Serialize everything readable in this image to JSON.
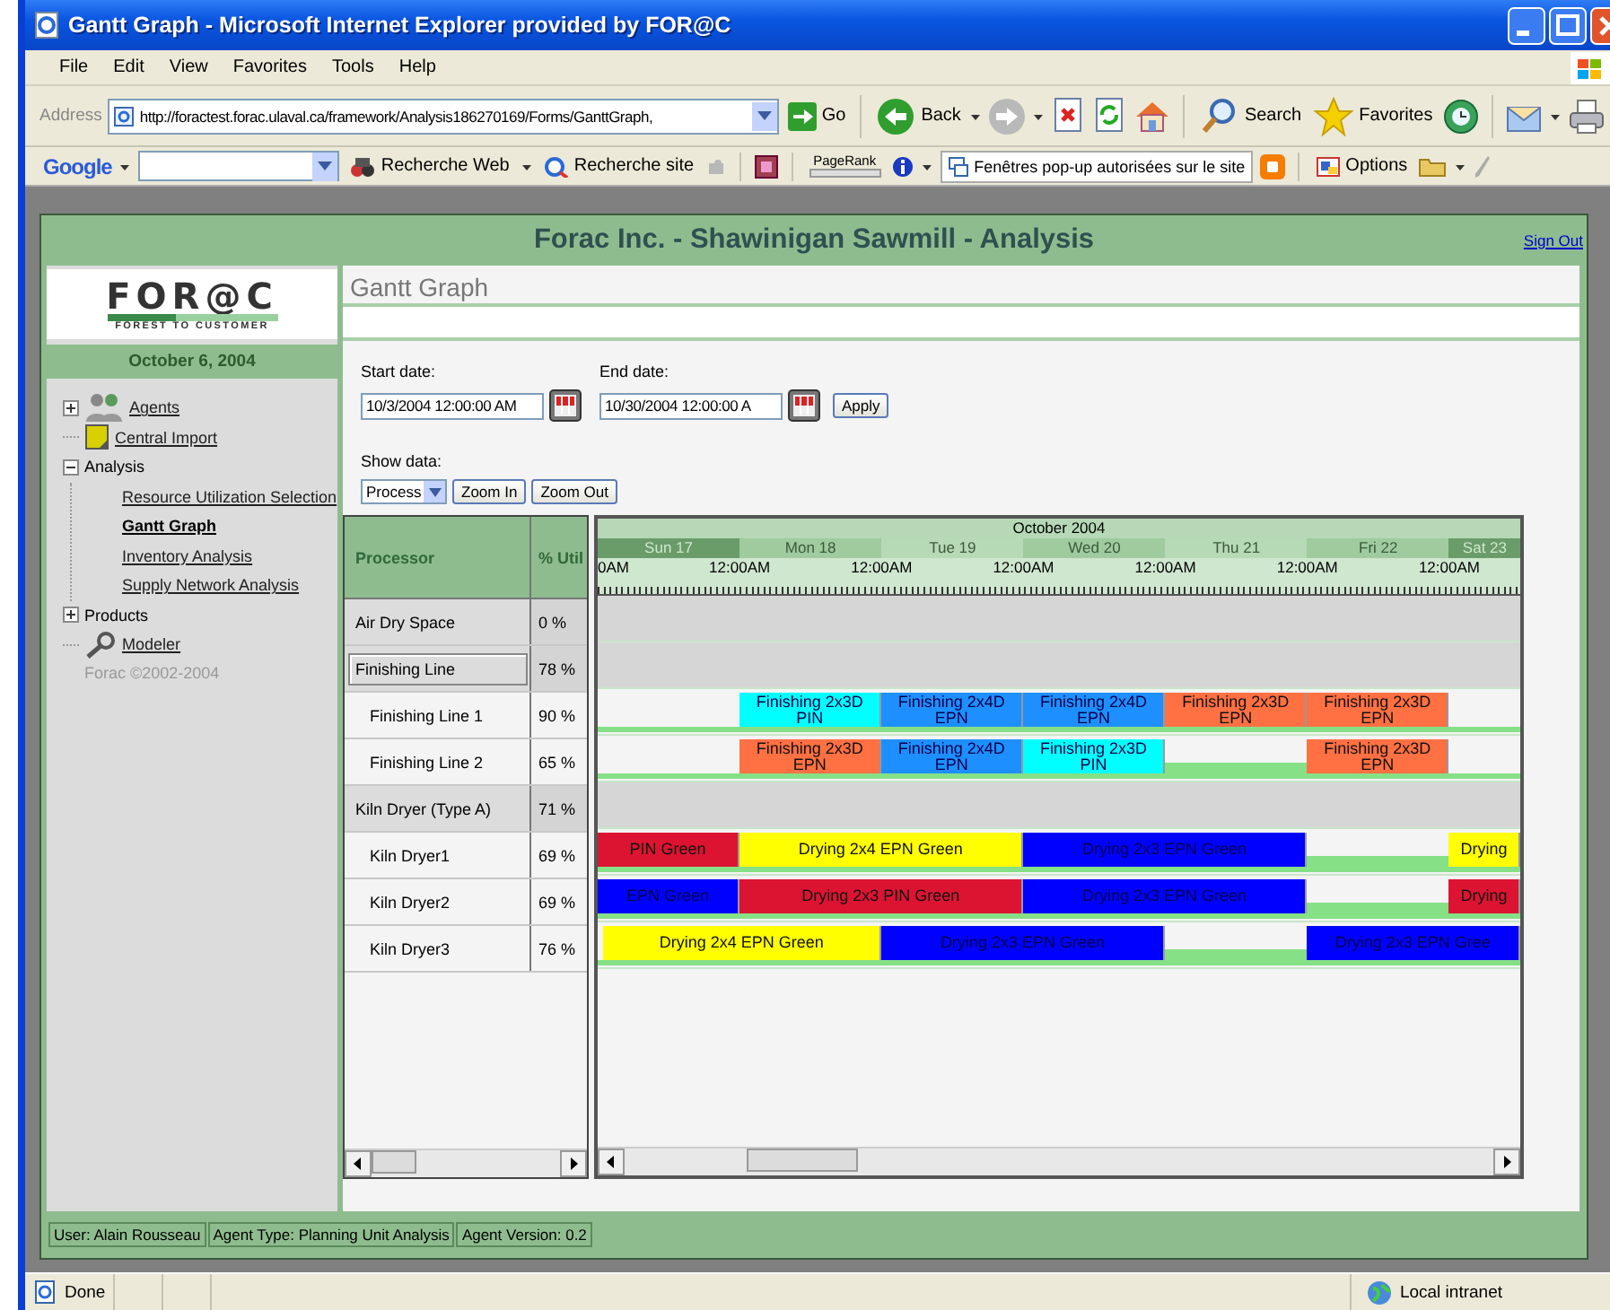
{
  "window": {
    "title": "Gantt Graph - Microsoft Internet Explorer provided by FOR@C"
  },
  "menu": [
    "File",
    "Edit",
    "View",
    "Favorites",
    "Tools",
    "Help"
  ],
  "address_bar": {
    "label": "Address",
    "value": "http://foractest.forac.ulaval.ca/framework/Analysis186270169/Forms/GanttGraph,",
    "go_label": "Go"
  },
  "toolbar": [
    {
      "kind": "back",
      "label": "Back"
    },
    {
      "kind": "forward"
    },
    {
      "kind": "stop"
    },
    {
      "kind": "refresh"
    },
    {
      "kind": "home"
    },
    {
      "kind": "search",
      "label": "Search"
    },
    {
      "kind": "favorites",
      "label": "Favorites"
    },
    {
      "kind": "history"
    },
    {
      "kind": "mail"
    },
    {
      "kind": "print"
    }
  ],
  "google_bar": {
    "logo": "Google",
    "items": [
      {
        "kind": "web",
        "label": "Recherche Web"
      },
      {
        "kind": "site",
        "label": "Recherche site"
      },
      {
        "kind": "pagerank",
        "label": "PageRank"
      },
      {
        "kind": "popup",
        "label": "Fenêtres pop-up autorisées sur le site"
      },
      {
        "kind": "options",
        "label": "Options"
      }
    ]
  },
  "app": {
    "title": "Forac Inc. - Shawinigan Sawmill - Analysis",
    "sign_out": "Sign Out",
    "logo": "FOR@C",
    "tagline": "FOREST TO CUSTOMER",
    "date": "October 6, 2004",
    "nav": [
      {
        "label": "Agents",
        "kind": "people",
        "expanded": false,
        "selected": false
      },
      {
        "label": "Central Import",
        "kind": "note",
        "selected": false
      },
      {
        "label": "Analysis",
        "kind": "plain",
        "expanded": true,
        "children": [
          {
            "label": "Resource Utilization Selection",
            "selected": false
          },
          {
            "label": "Gantt Graph",
            "selected": true
          },
          {
            "label": "Inventory Analysis",
            "selected": false
          },
          {
            "label": "Supply Network Analysis",
            "selected": false
          }
        ]
      },
      {
        "label": "Products",
        "kind": "plain",
        "expanded": false
      },
      {
        "label": "Modeler",
        "kind": "tool",
        "selected": false
      }
    ],
    "copyright": "Forac ©2002-2004",
    "page_title": "Gantt Graph",
    "start_date": {
      "label": "Start date:",
      "value": "10/3/2004 12:00:00 AM"
    },
    "end_date": {
      "label": "End date:",
      "value": "10/30/2004 12:00:00 A"
    },
    "apply": "Apply",
    "show_data": {
      "label": "Show data:",
      "value": "Process"
    },
    "zoom_in": "Zoom In",
    "zoom_out": "Zoom Out",
    "gantt": {
      "columns": [
        "Processor",
        "% Util"
      ],
      "month": "October 2004",
      "days": [
        {
          "label": "Sun 17",
          "weekend": true,
          "hour": "0AM"
        },
        {
          "label": "Mon 18",
          "weekend": false,
          "hour": "12:00AM"
        },
        {
          "label": "Tue 19",
          "weekend": false,
          "hour": "12:00AM"
        },
        {
          "label": "Wed 20",
          "weekend": false,
          "hour": "12:00AM"
        },
        {
          "label": "Thu 21",
          "weekend": false,
          "hour": "12:00AM"
        },
        {
          "label": "Fri 22",
          "weekend": false,
          "hour": "12:00AM"
        },
        {
          "label": "Sat 23",
          "weekend": true,
          "hour": "12:00AM"
        }
      ],
      "processors": [
        {
          "name": "Air Dry Space",
          "util": "0 %",
          "selected": false
        },
        {
          "name": "Finishing Line",
          "util": "78 %",
          "selected": true,
          "children": [
            {
              "name": "Finishing Line 1",
              "util": "90 %",
              "selected": false,
              "bars": [
                {
                  "kind": "task",
                  "label": "Finishing 2x3D\nPIN",
                  "color": "#00ffff"
                },
                {
                  "kind": "task",
                  "label": "Finishing 2x4D\nEPN",
                  "color": "#1e8fff"
                },
                {
                  "kind": "task",
                  "label": "Finishing 2x4D\nEPN",
                  "color": "#1e8fff"
                },
                {
                  "kind": "task",
                  "label": "Finishing 2x3D\nEPN",
                  "color": "#ff7043"
                },
                {
                  "kind": "task",
                  "label": "Finishing 2x3D\nEPN",
                  "color": "#ff7043"
                }
              ]
            },
            {
              "name": "Finishing Line 2",
              "util": "65 %",
              "selected": false,
              "bars": [
                {
                  "kind": "task",
                  "label": "Finishing 2x3D\nEPN",
                  "color": "#ff7043"
                },
                {
                  "kind": "task",
                  "label": "Finishing 2x4D\nEPN",
                  "color": "#1e8fff"
                },
                {
                  "kind": "task",
                  "label": "Finishing 2x3D\nPIN",
                  "color": "#00ffff"
                },
                {
                  "kind": "idle"
                },
                {
                  "kind": "task",
                  "label": "Finishing 2x3D\nEPN",
                  "color": "#ff7043"
                }
              ]
            }
          ]
        },
        {
          "name": "Kiln Dryer (Type A)",
          "util": "71 %",
          "selected": false,
          "children": [
            {
              "name": "Kiln Dryer1",
              "util": "69 %",
              "selected": false,
              "bars": [
                {
                  "kind": "task",
                  "label": "PIN Green",
                  "color": "#dc1432"
                },
                {
                  "kind": "task",
                  "label": "Drying 2x4 EPN Green",
                  "color": "#ffff00"
                },
                {
                  "kind": "task",
                  "label": "Drying 2x3 EPN Green",
                  "color": "#0000ff"
                },
                {
                  "kind": "idle"
                },
                {
                  "kind": "task",
                  "label": "Drying",
                  "color": "#ffff00"
                }
              ]
            },
            {
              "name": "Kiln Dryer2",
              "util": "69 %",
              "selected": false,
              "bars": [
                {
                  "kind": "task",
                  "label": "EPN Green",
                  "color": "#0000ff"
                },
                {
                  "kind": "task",
                  "label": "Drying 2x3 PIN Green",
                  "color": "#dc1432"
                },
                {
                  "kind": "task",
                  "label": "Drying 2x3 EPN Green",
                  "color": "#0000ff"
                },
                {
                  "kind": "idle"
                },
                {
                  "kind": "task",
                  "label": "Drying",
                  "color": "#dc1432"
                }
              ]
            },
            {
              "name": "Kiln Dryer3",
              "util": "76 %",
              "selected": false,
              "bars": [
                {
                  "kind": "task",
                  "label": "Drying 2x4 EPN Green",
                  "color": "#ffff00"
                },
                {
                  "kind": "task",
                  "label": "Drying 2x3 EPN Green",
                  "color": "#0000ff"
                },
                {
                  "kind": "idle"
                },
                {
                  "kind": "task",
                  "label": "Drying 2x3 EPN Gree",
                  "color": "#0000ff"
                }
              ]
            }
          ]
        }
      ]
    },
    "footer": [
      "User: Alain Rousseau",
      "Agent Type: Planning Unit Analysis",
      "Agent Version: 0.2"
    ]
  },
  "status_bar": {
    "text": "Done",
    "zone": "Local intranet"
  }
}
